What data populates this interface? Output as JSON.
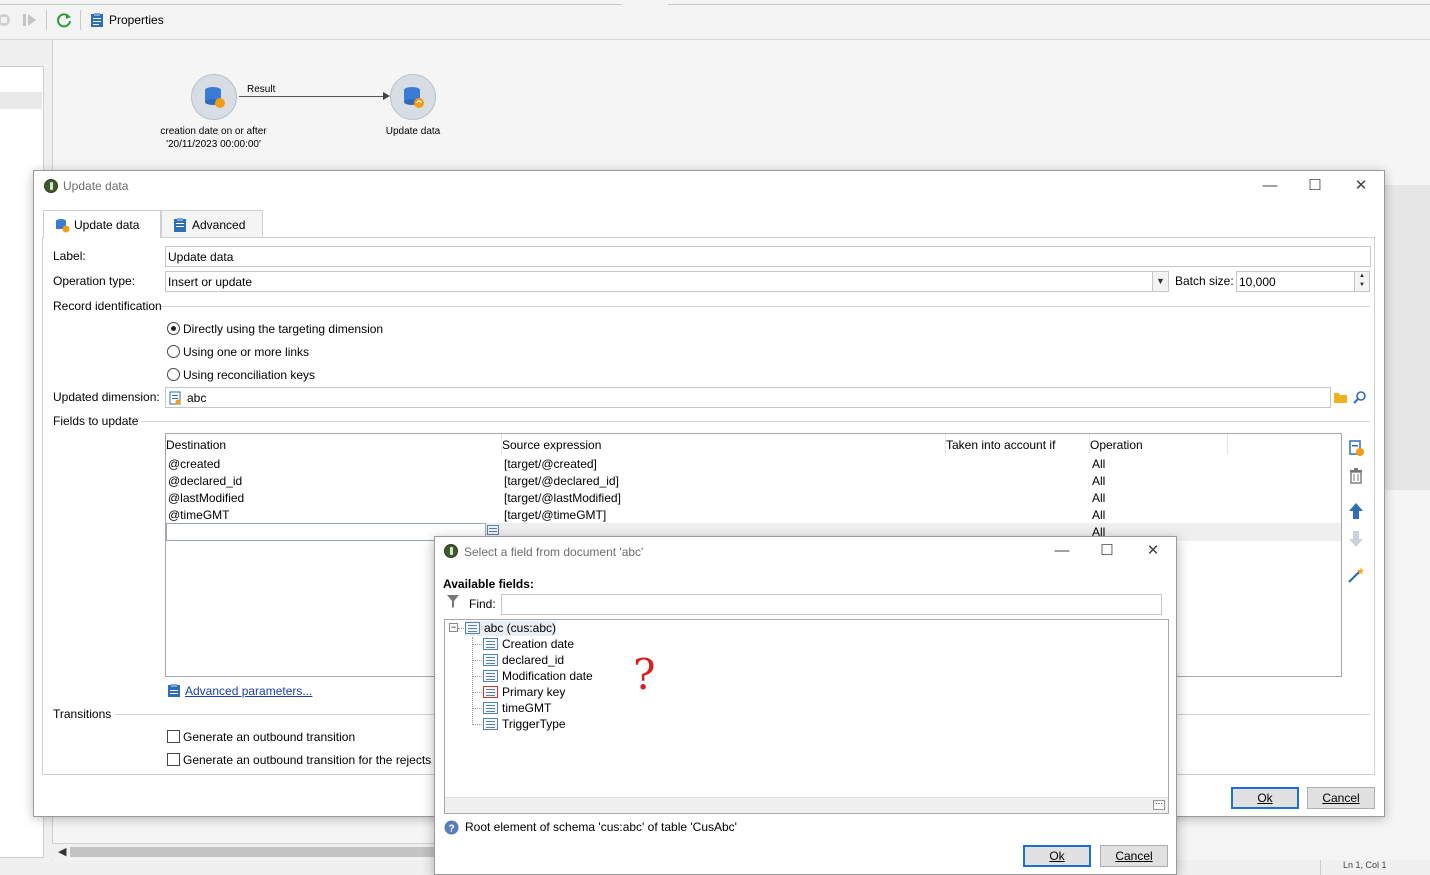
{
  "toolbar": {
    "properties_label": "Properties"
  },
  "workflow": {
    "node1_caption_line1": "creation date on or after",
    "node1_caption_line2": "'20/11/2023 00:00:00'",
    "transition_label": "Result",
    "node2_caption": "Update data"
  },
  "dialog": {
    "title": "Update data",
    "tabs": [
      "Update data",
      "Advanced"
    ],
    "label_label": "Label:",
    "label_value": "Update data",
    "operation_type_label": "Operation type:",
    "operation_type_value": "Insert or update",
    "batch_size_label": "Batch size:",
    "batch_size_value": "10,000",
    "record_identification_label": "Record identification",
    "radio_options": [
      "Directly using the targeting dimension",
      "Using one or more links",
      "Using reconciliation keys"
    ],
    "selected_radio": 0,
    "updated_dimension_label": "Updated dimension:",
    "updated_dimension_value": "abc",
    "fields_to_update_label": "Fields to update",
    "grid": {
      "columns": [
        "Destination",
        "Source expression",
        "Taken into account if",
        "Operation"
      ],
      "rows": [
        [
          "@created",
          "[target/@created]",
          "",
          "All"
        ],
        [
          "@declared_id",
          "[target/@declared_id]",
          "",
          "All"
        ],
        [
          "@lastModified",
          "[target/@lastModified]",
          "",
          "All"
        ],
        [
          "@timeGMT",
          "[target/@timeGMT]",
          "",
          "All"
        ]
      ],
      "new_row_operation": "All"
    },
    "advanced_parameters_link": "Advanced parameters...",
    "transitions_label": "Transitions",
    "checkboxes": [
      "Generate an outbound transition",
      "Generate an outbound transition for the rejects"
    ],
    "ok_label": "Ok",
    "cancel_label": "Cancel"
  },
  "select_dialog": {
    "title": "Select a field from document 'abc'",
    "available_fields_label": "Available fields:",
    "find_label": "Find:",
    "find_value": "",
    "tree_root": "abc (cus:abc)",
    "tree_children": [
      "Creation date",
      "declared_id",
      "Modification date",
      "Primary key",
      "timeGMT",
      "TriggerType"
    ],
    "annotation": "?",
    "status_text": "Root element of schema 'cus:abc' of table 'CusAbc'",
    "ok_label": "Ok",
    "cancel_label": "Cancel"
  },
  "statusbar": {
    "position": "Ln 1, Col 1"
  },
  "colors": {
    "link": "#1a3fb0",
    "accent": "#1c6fd3",
    "node_fill": "#d7dde3",
    "annotation": "#d62020"
  }
}
